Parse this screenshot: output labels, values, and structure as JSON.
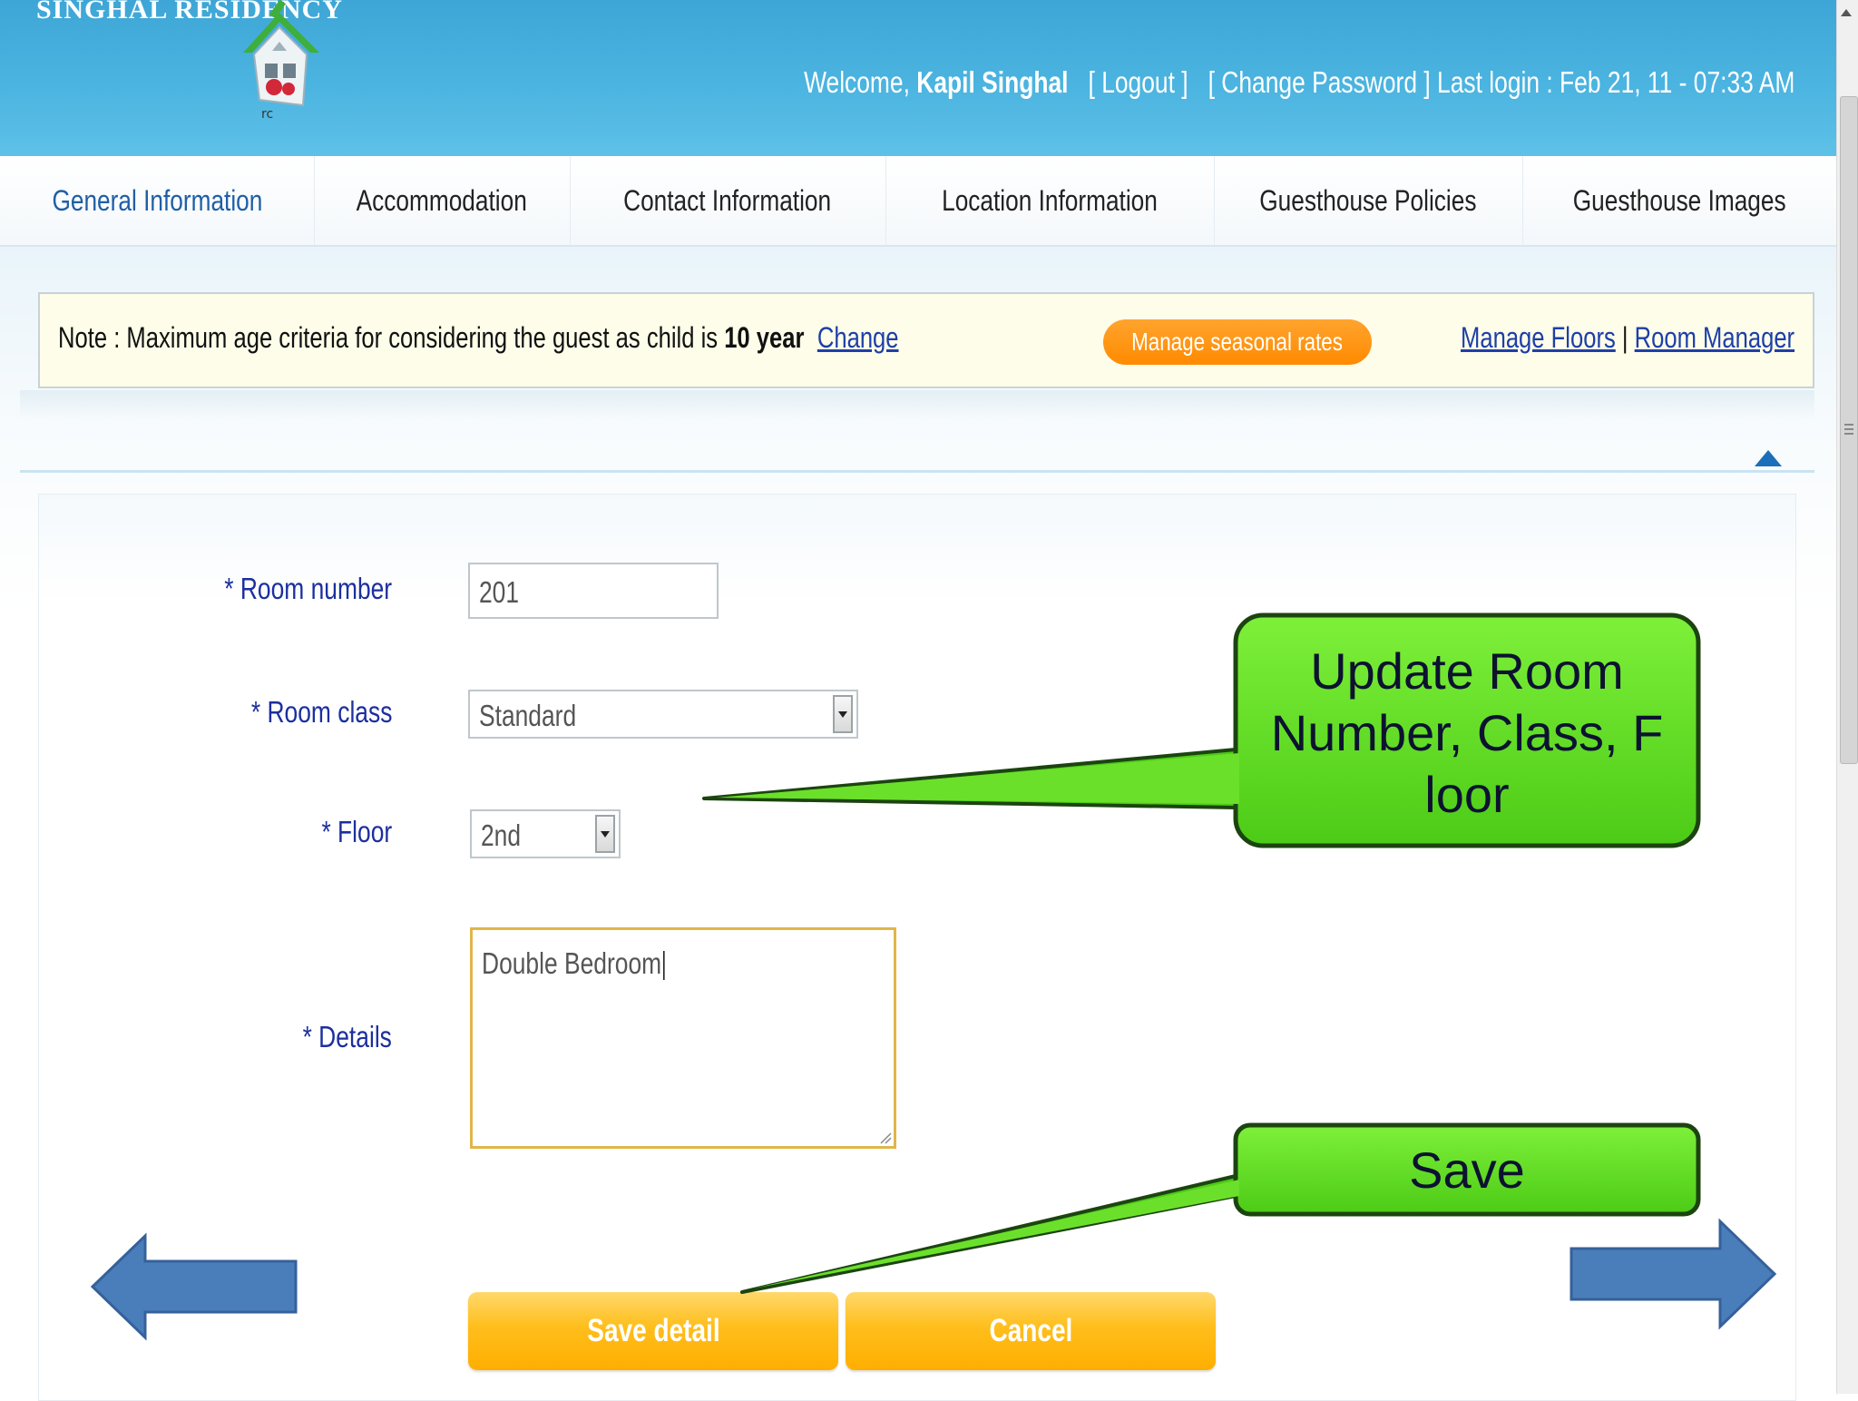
{
  "header": {
    "brand": "SINGHAL RESIDENCY",
    "welcome_prefix": "Welcome, ",
    "user_name": "Kapil Singhal",
    "logout": "[ Logout ]",
    "change_password": "[ Change Password ]",
    "last_login": "Last login : Feb 21, 11 - 07:33 AM"
  },
  "tabs": [
    {
      "label": "General Information",
      "active": true
    },
    {
      "label": "Accommodation"
    },
    {
      "label": "Contact Information"
    },
    {
      "label": "Location Information"
    },
    {
      "label": "Guesthouse Policies"
    },
    {
      "label": "Guesthouse Images"
    }
  ],
  "note": {
    "prefix": "Note : Maximum age criteria for considering the guest as child is ",
    "age": "10 year",
    "change_link": "Change",
    "seasonal_button": "Manage seasonal rates",
    "manage_floors": "Manage Floors",
    "separator": "|",
    "room_manager": "Room Manager"
  },
  "form": {
    "room_number_label": "* Room number",
    "room_number_value": "201",
    "room_class_label": "* Room class",
    "room_class_value": "Standard",
    "floor_label": "* Floor",
    "floor_value": "2nd",
    "details_label": "* Details",
    "details_value": "Double Bedroom",
    "save_button": "Save detail",
    "cancel_button": "Cancel"
  },
  "annotations": {
    "callout_update": [
      "Update Room",
      "Number, Class, F",
      "loor"
    ],
    "callout_save": "Save"
  },
  "colors": {
    "header_blue": "#4bb4e0",
    "link_blue": "#1d3fa8",
    "label_blue": "#1c2f9e",
    "orange": "#ff8a00",
    "yellow_button": "#ffbe1c",
    "callout_green": "#5ee01c",
    "arrow_blue": "#4a7ebb"
  }
}
